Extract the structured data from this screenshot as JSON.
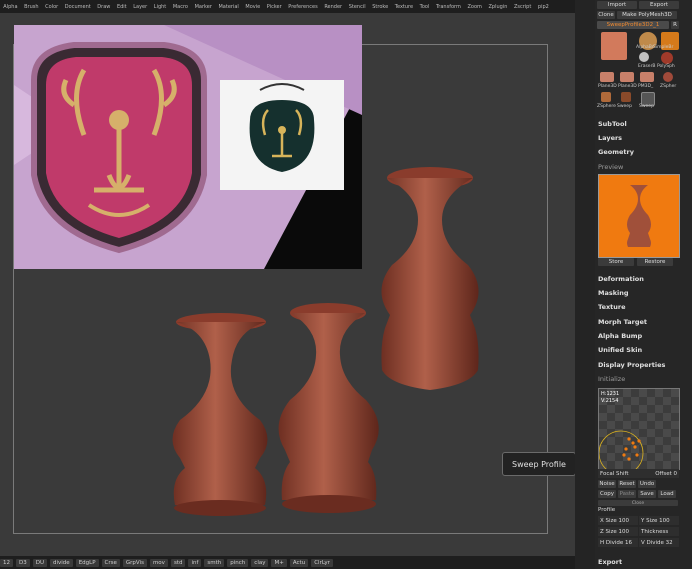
{
  "menu": [
    "Alpha",
    "Brush",
    "Color",
    "Document",
    "Draw",
    "Edit",
    "Layer",
    "Light",
    "Macro",
    "Marker",
    "Material",
    "Movie",
    "Picker",
    "Preferences",
    "Render",
    "Stencil",
    "Stroke",
    "Texture",
    "Tool",
    "Transform",
    "Zoom",
    "Zplugin",
    "Zscript",
    "pip2"
  ],
  "tooltip": "Sweep Profile",
  "bottom": [
    "12",
    "D3",
    "DU",
    "divide",
    "EdgLP",
    "Crse",
    "GrpVis",
    "mov",
    "std",
    "inf",
    "smth",
    "pinch",
    "clay",
    "M+",
    "Actu",
    "ClrLyr"
  ],
  "panel": {
    "top_buttons": [
      "Import",
      "Export"
    ],
    "row2": [
      "Clone",
      "Make PolyMesh3D"
    ],
    "current_tool": "SweepProfile3D2_1",
    "r_label": "R",
    "tiles": [
      "SweepProfile3D",
      "AlphaBr",
      "SimpleBr",
      "EraserB",
      "PolySph",
      "Plane3D",
      "Plane3D",
      "PM3D_",
      "ZSpher",
      "ZSphere",
      "Sweep",
      "Sweep"
    ],
    "sections1": [
      "SubTool",
      "Layers",
      "Geometry"
    ],
    "preview_header": "Preview",
    "store": "Store",
    "restore": "Restore",
    "sections2": [
      "Deformation",
      "Masking",
      "Texture",
      "Morph Target",
      "Alpha Bump",
      "Unified Skin",
      "Display Properties"
    ],
    "initialize": "Initialize",
    "readout": [
      "H:1231",
      "V:2154"
    ],
    "focal_shift": "Focal Shift",
    "offset": "Offset 0",
    "row_a": [
      "Noise",
      "Reset",
      "Undo"
    ],
    "row_b": [
      "Copy",
      "Paste",
      "Save",
      "Load"
    ],
    "close": "Close",
    "profile": "Profile",
    "xsize": "X Size 100",
    "ysize": "Y Size 100",
    "zsize": "Z Size 100",
    "thickness": "Thickness",
    "hdiv": "H Divide 16",
    "vdiv": "V Divide 32",
    "export": "Export"
  },
  "colors": {
    "accent": "#f07a10",
    "vase": "#9c4a34"
  }
}
